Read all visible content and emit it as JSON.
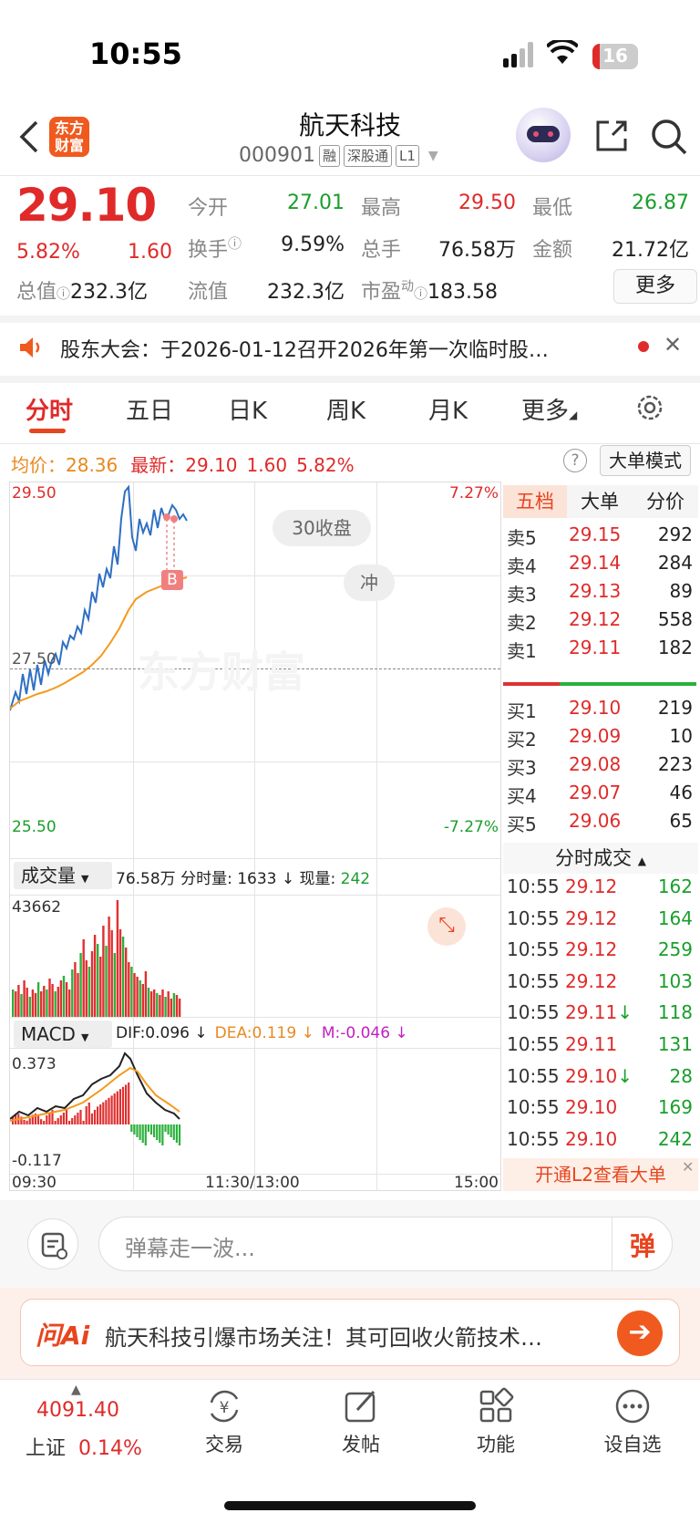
{
  "status": {
    "time": "10:55",
    "battery": "16"
  },
  "header": {
    "logo": "东方\n财富",
    "title": "航天科技",
    "code": "000901",
    "tags": [
      "融",
      "深股通",
      "L1"
    ]
  },
  "quote": {
    "price": "29.10",
    "pct": "5.82%",
    "chg": "1.60",
    "open_l": "今开",
    "open_v": "27.01",
    "high_l": "最高",
    "high_v": "29.50",
    "low_l": "最低",
    "low_v": "26.87",
    "turn_l": "换手",
    "turn_v": "9.59%",
    "vol_l": "总手",
    "vol_v": "76.58万",
    "amt_l": "金额",
    "amt_v": "21.72亿",
    "mcap_l": "总值",
    "mcap_v": "232.3亿",
    "float_l": "流值",
    "float_v": "232.3亿",
    "pe_l": "市盈",
    "pe_sup": "动",
    "pe_v": "183.58",
    "more": "更多"
  },
  "notice": {
    "text": "股东大会：于2026-01-12召开2026年第一次临时股…"
  },
  "tabs": [
    "分时",
    "五日",
    "日K",
    "周K",
    "月K",
    "更多"
  ],
  "chart": {
    "avg_label": "均价：",
    "avg": "28.36",
    "latest_label": "最新：",
    "latest": "29.10",
    "chg": "1.60",
    "pct": "5.82%",
    "mode": "大单模式",
    "y_top": "29.50",
    "y_mid": "27.50",
    "y_bot": "25.50",
    "pct_top": "7.27%",
    "pct_bot": "-7.27%",
    "bubble1": "30收盘",
    "bubble2": "冲",
    "watermark": "东方财富",
    "b_mark": "B",
    "vol_sel": "成交量",
    "vol_info": "76.58万 分时量: 1633 ↓ 现量:",
    "vol_now": "242",
    "vol_max": "43662",
    "macd_sel": "MACD",
    "dif": "DIF:0.096 ↓",
    "dea": "DEA:0.119 ↓",
    "m": "M:-0.046 ↓",
    "macd_top": "0.373",
    "macd_bot": "-0.117",
    "x0": "09:30",
    "x1": "11:30/13:00",
    "x2": "15:00"
  },
  "orderbook": {
    "tabs": [
      "五档",
      "大单",
      "分价"
    ],
    "asks": [
      [
        "卖5",
        "29.15",
        "292"
      ],
      [
        "卖4",
        "29.14",
        "284"
      ],
      [
        "卖3",
        "29.13",
        "89"
      ],
      [
        "卖2",
        "29.12",
        "558"
      ],
      [
        "卖1",
        "29.11",
        "182"
      ]
    ],
    "bids": [
      [
        "买1",
        "29.10",
        "219"
      ],
      [
        "买2",
        "29.09",
        "10"
      ],
      [
        "买3",
        "29.08",
        "223"
      ],
      [
        "买4",
        "29.07",
        "46"
      ],
      [
        "买5",
        "29.06",
        "65"
      ]
    ],
    "trades_title": "分时成交",
    "trades": [
      [
        "10:55",
        "29.12",
        "162",
        ""
      ],
      [
        "10:55",
        "29.12",
        "164",
        ""
      ],
      [
        "10:55",
        "29.12",
        "259",
        ""
      ],
      [
        "10:55",
        "29.12",
        "103",
        ""
      ],
      [
        "10:55",
        "29.11↓",
        "118",
        ""
      ],
      [
        "10:55",
        "29.11",
        "131",
        ""
      ],
      [
        "10:55",
        "29.10↓",
        "28",
        ""
      ],
      [
        "10:55",
        "29.10",
        "169",
        ""
      ],
      [
        "10:55",
        "29.10",
        "242",
        ""
      ]
    ],
    "l2": "开通L2查看大单"
  },
  "danmu": {
    "placeholder": "弹幕走一波...",
    "btn": "弹"
  },
  "ai": {
    "logo": "问Ai",
    "text": "航天科技引爆市场关注！其可回收火箭技术…"
  },
  "bottom": {
    "index_val": "4091.40",
    "index_name": "上证",
    "index_pct": "0.14%",
    "items": [
      "交易",
      "发帖",
      "功能",
      "设自选"
    ]
  }
}
